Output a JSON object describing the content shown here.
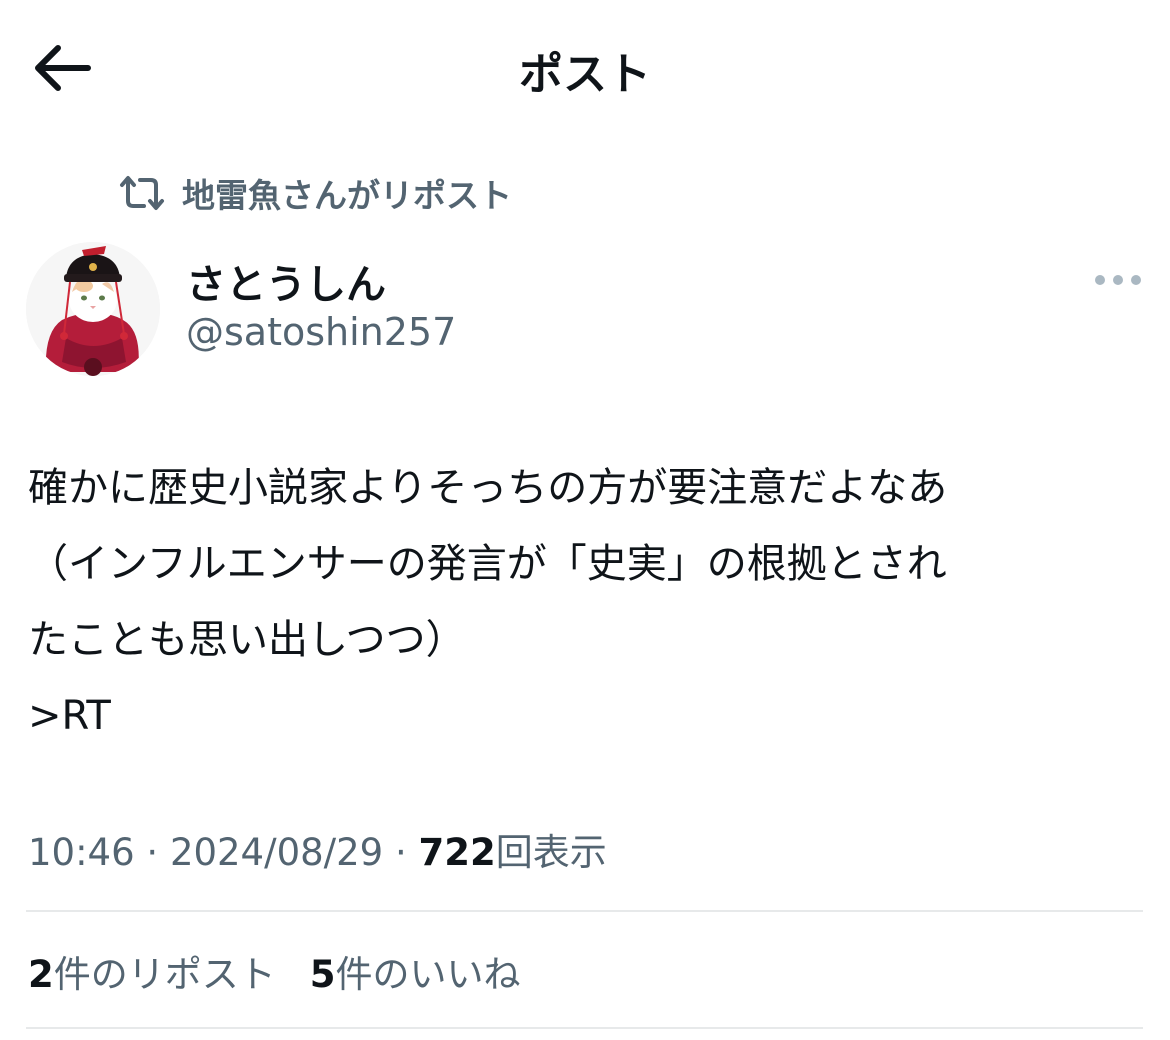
{
  "header": {
    "title": "ポスト"
  },
  "repost": {
    "label": "地雷魚さんがリポスト"
  },
  "author": {
    "display_name": "さとうしん",
    "handle": "@satoshin257"
  },
  "post": {
    "lines": [
      "確かに歴史小説家よりそっちの方が要注意だよなあ",
      "（インフルエンサーの発言が「史実」の根拠とされ",
      "たことも思い出しつつ）",
      ">RT"
    ]
  },
  "meta": {
    "time": "10:46",
    "separator": "·",
    "date": "2024/08/29",
    "views_count": "722",
    "views_label": "回表示"
  },
  "stats": {
    "reposts_count": "2",
    "reposts_label": "件のリポスト",
    "likes_count": "5",
    "likes_label": "件のいいね"
  },
  "colors": {
    "text": "#0f1419",
    "secondary": "#536471",
    "divider": "#e7e9ea"
  }
}
